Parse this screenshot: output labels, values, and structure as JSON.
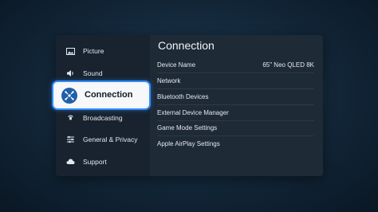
{
  "sidebar": {
    "items": [
      {
        "label": "Picture",
        "icon": "picture-icon"
      },
      {
        "label": "Sound",
        "icon": "sound-icon"
      },
      {
        "label": "Connection",
        "icon": "connection-icon",
        "selected": true
      },
      {
        "label": "Broadcasting",
        "icon": "broadcasting-icon"
      },
      {
        "label": "General & Privacy",
        "icon": "general-privacy-icon"
      },
      {
        "label": "Support",
        "icon": "support-icon"
      }
    ]
  },
  "main": {
    "title": "Connection",
    "rows": [
      {
        "label": "Device Name",
        "value": "65\" Neo QLED 8K"
      },
      {
        "label": "Network",
        "value": ""
      },
      {
        "label": "Bluetooth Devices",
        "value": ""
      },
      {
        "label": "External Device Manager",
        "value": ""
      },
      {
        "label": "Game Mode Settings",
        "value": ""
      },
      {
        "label": "Apple AirPlay Settings",
        "value": ""
      }
    ]
  },
  "colors": {
    "focus_border": "#2f8dff",
    "focus_icon_bg": "#1e5fa8",
    "panel_bg": "#1f2a37",
    "sidebar_bg": "#18232f"
  }
}
